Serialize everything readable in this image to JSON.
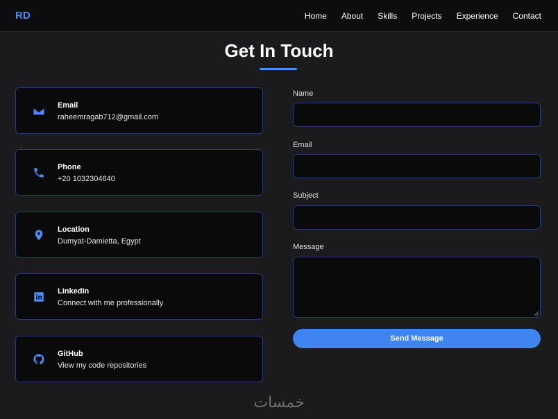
{
  "header": {
    "logo": "RD",
    "nav": [
      "Home",
      "About",
      "Skills",
      "Projects",
      "Experience",
      "Contact"
    ]
  },
  "main": {
    "title": "Get In Touch"
  },
  "contact_cards": [
    {
      "icon": "envelope-icon",
      "title": "Email",
      "value": "raheemragab712@gmail.com"
    },
    {
      "icon": "phone-icon",
      "title": "Phone",
      "value": "+20 1032304640"
    },
    {
      "icon": "map-pin-icon",
      "title": "Location",
      "value": "Dumyat-Damietta, Egypt"
    },
    {
      "icon": "linkedin-icon",
      "title": "LinkedIn",
      "value": "Connect with me professionally"
    },
    {
      "icon": "github-icon",
      "title": "GitHub",
      "value": "View my code repositories"
    }
  ],
  "form": {
    "name_label": "Name",
    "email_label": "Email",
    "subject_label": "Subject",
    "message_label": "Message",
    "name_value": "",
    "email_value": "",
    "subject_value": "",
    "message_value": "",
    "submit_label": "Send Message"
  },
  "watermark": "خمسات",
  "colors": {
    "accent": "#4a8df5",
    "button": "#3f84f0",
    "background": "#1b1b1d",
    "card_border": "#2b3a78"
  }
}
